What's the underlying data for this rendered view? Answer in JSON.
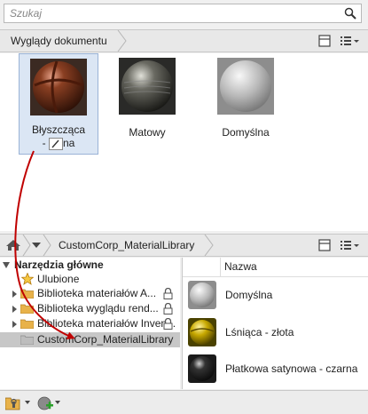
{
  "search": {
    "placeholder": "Szukaj"
  },
  "doc_bar": {
    "breadcrumb": "Wyglądy dokumentu"
  },
  "doc_materials": [
    {
      "label": "Błyszcząca - ...na",
      "line1": "Błyszcząca",
      "line2_pre": "- ",
      "line2_post": "na"
    },
    {
      "label": "Matowy"
    },
    {
      "label": "Domyślna"
    }
  ],
  "library_bar": {
    "breadcrumb": "CustomCorp_MaterialLibrary"
  },
  "tree": {
    "header": "Narzędzia główne",
    "items": [
      {
        "label": "Ulubione"
      },
      {
        "label": "Biblioteka materiałów A..."
      },
      {
        "label": "Biblioteka wyglądu rend..."
      },
      {
        "label": "Biblioteka materiałów Inven..."
      },
      {
        "label": "CustomCorp_MaterialLibrary"
      }
    ]
  },
  "list": {
    "column_header": "Nazwa",
    "items": [
      {
        "name": "Domyślna"
      },
      {
        "name": "Lśniąca - złota"
      },
      {
        "name": "Płatkowa satynowa - czarna"
      }
    ]
  },
  "colors": {
    "accent": "#c00000",
    "selection": "#dbe6f4",
    "folder": "#e8b24a"
  }
}
